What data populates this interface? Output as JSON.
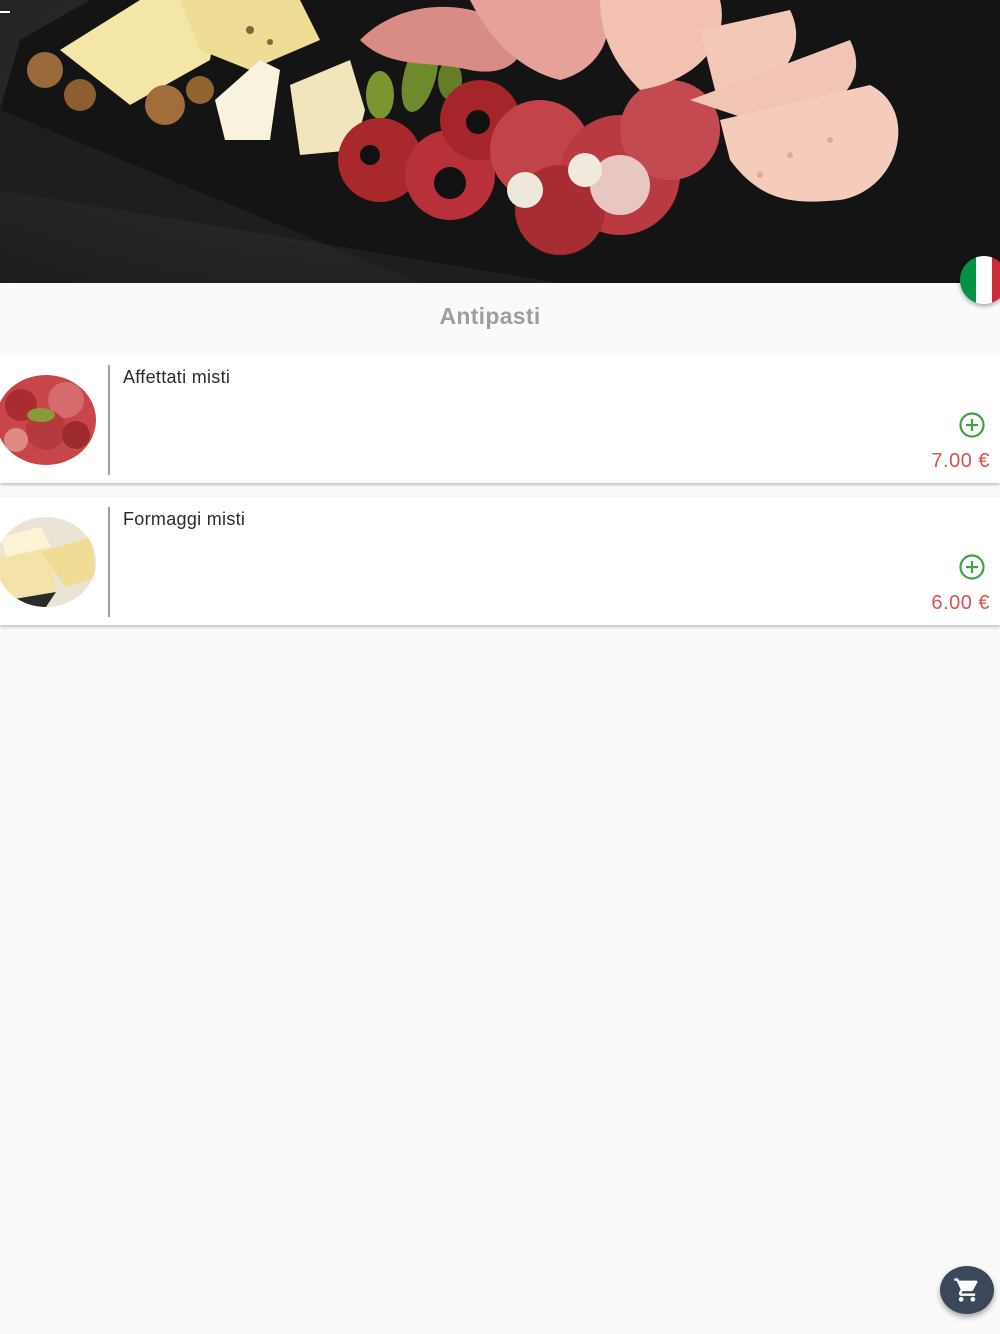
{
  "hero": {
    "image": "charcuterie-and-cheese-board",
    "back_icon": "arrow-back-icon",
    "language_icon": "italian-flag-icon",
    "flag_colors": [
      "#009246",
      "#ffffff",
      "#ce2b37"
    ]
  },
  "section": {
    "title": "Antipasti"
  },
  "items": [
    {
      "name": "Affettati misti",
      "price": "7.00 €",
      "image": "cured-meats-platter",
      "add_icon": "add-circle-icon"
    },
    {
      "name": "Formaggi misti",
      "price": "6.00 €",
      "image": "cheese-wedges",
      "add_icon": "add-circle-icon"
    }
  ],
  "cart": {
    "icon": "shopping-cart-icon"
  },
  "colors": {
    "accent_green": "#43a047",
    "price_red": "#d9534f",
    "title_gray": "#9e9e9e",
    "fab_bg": "#3c4759"
  }
}
